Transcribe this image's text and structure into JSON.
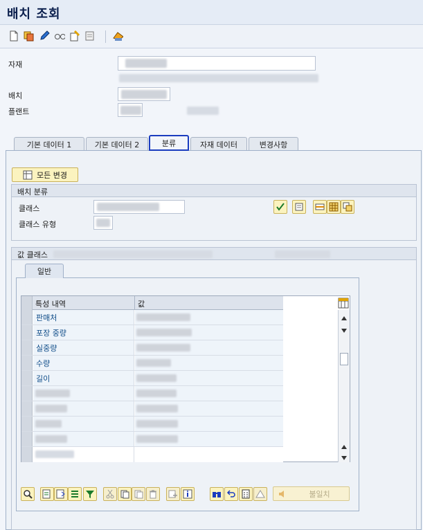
{
  "window": {
    "title": "배치 조회"
  },
  "fields": {
    "material_label": "자재",
    "batch_label": "배치",
    "plant_label": "플랜트"
  },
  "tabs": [
    {
      "label": "기본 데이터 1"
    },
    {
      "label": "기본 데이터 2"
    },
    {
      "label": "분류",
      "selected": true
    },
    {
      "label": "자재 데이터"
    },
    {
      "label": "변경사항"
    }
  ],
  "buttons": {
    "all_changes": "모든 변경",
    "mismatch": "불일치"
  },
  "batch_class": {
    "title": "배치 분류",
    "class_label": "클래스",
    "class_type_label": "클래스 유형"
  },
  "value_class": {
    "title": "값 클래스"
  },
  "inner_tab": {
    "label": "일반"
  },
  "grid": {
    "col1": "특성 내역",
    "col2": "값",
    "rows": [
      "판매처",
      "포장 중량",
      "실중량",
      "수량",
      "길이",
      "",
      "",
      "",
      "",
      ""
    ]
  },
  "icons": {
    "toolbar": [
      "new-document-icon",
      "copy-icon",
      "edit-pencil-icon",
      "glasses-icon",
      "change-doc-icon",
      "print-icon",
      "org-icon"
    ],
    "colors": {
      "accent": "#1a3cbf",
      "button_bg": "#fbf3bf",
      "title": "#0b1f4d"
    }
  }
}
